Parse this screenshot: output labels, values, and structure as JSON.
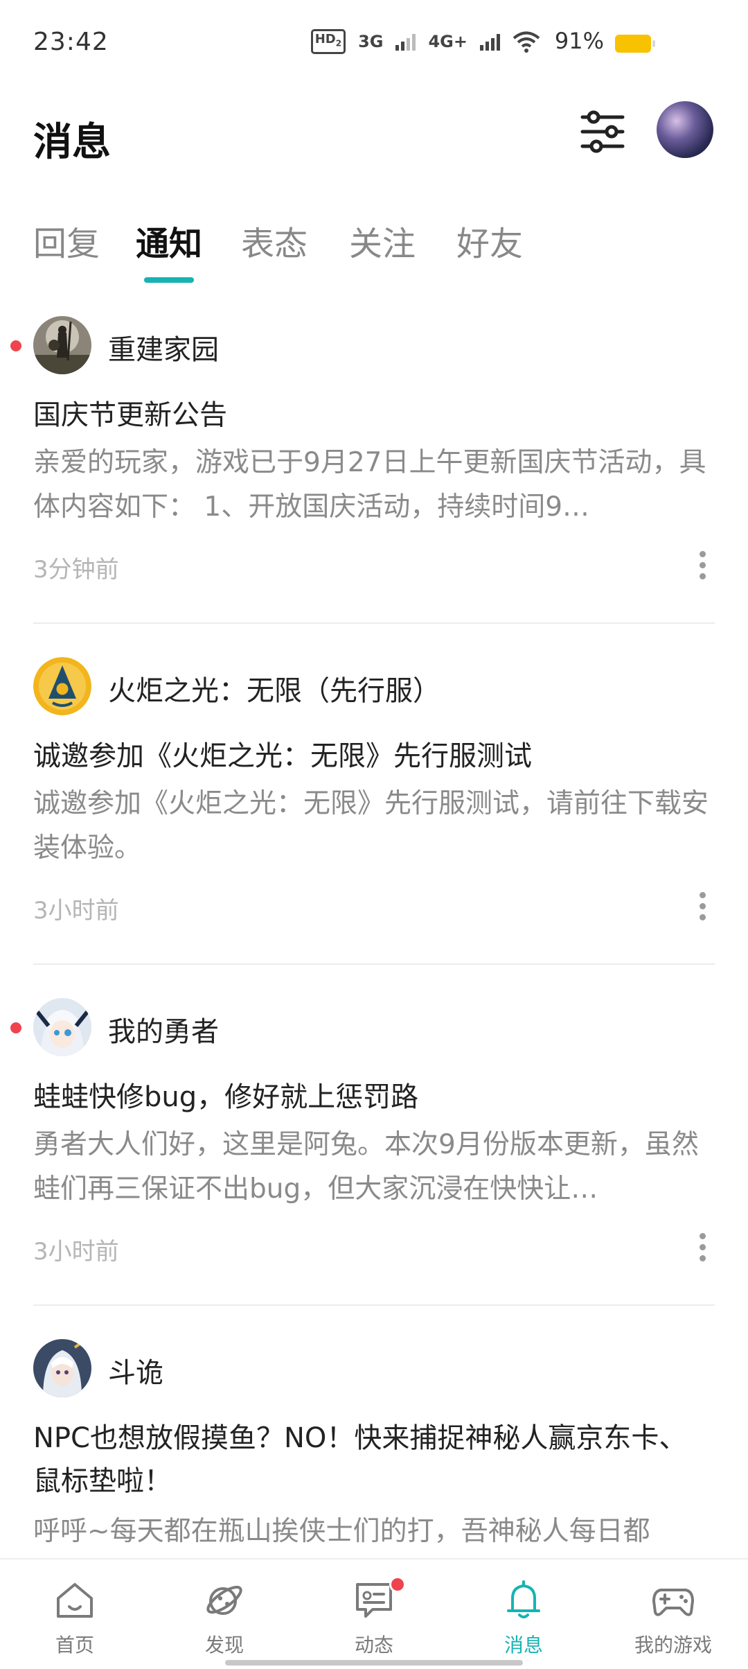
{
  "status_bar": {
    "time": "23:42",
    "hd": "HD",
    "hd_sub": "2",
    "net1": "3G",
    "net2": "4G+",
    "battery": "91%",
    "battery_color": "#f8c200"
  },
  "header": {
    "title": "消息",
    "filter_icon": "sliders-icon",
    "avatar": "user-avatar"
  },
  "tabs": [
    {
      "label": "回复"
    },
    {
      "label": "通知",
      "active": true
    },
    {
      "label": "表态"
    },
    {
      "label": "关注"
    },
    {
      "label": "好友"
    }
  ],
  "feed": [
    {
      "app": "重建家园",
      "title": "国庆节更新公告",
      "body": "亲爱的玩家，游戏已于9月27日上午更新国庆节活动，具体内容如下： 1、开放国庆活动，持续时间9…",
      "time": "3分钟前",
      "unread": true
    },
    {
      "app": "火炬之光：无限（先行服）",
      "title": "诚邀参加《火炬之光：无限》先行服测试",
      "body": "诚邀参加《火炬之光：无限》先行服测试，请前往下载安装体验。",
      "time": "3小时前",
      "unread": false
    },
    {
      "app": "我的勇者",
      "title": "蛙蛙快修bug，修好就上惩罚路",
      "body": "勇者大人们好，这里是阿兔。本次9月份版本更新，虽然蛙们再三保证不出bug，但大家沉浸在快快让…",
      "time": "3小时前",
      "unread": true
    },
    {
      "app": "斗诡",
      "title": "NPC也想放假摸鱼？NO！快来捕捉神秘人赢京东卡、鼠标垫啦！",
      "body": "呼呼~每天都在瓶山挨侠士们的打，吾神秘人每日都",
      "time": "",
      "unread": false
    }
  ],
  "bottom_nav": [
    {
      "label": "首页",
      "icon": "home-icon"
    },
    {
      "label": "发现",
      "icon": "planet-icon"
    },
    {
      "label": "动态",
      "icon": "chat-icon",
      "badge": true
    },
    {
      "label": "消息",
      "icon": "bell-icon",
      "active": true
    },
    {
      "label": "我的游戏",
      "icon": "gamepad-icon"
    }
  ],
  "colors": {
    "accent": "#17b3b3",
    "unread_dot": "#f0434e",
    "secondary_text": "#8a8a8a"
  }
}
